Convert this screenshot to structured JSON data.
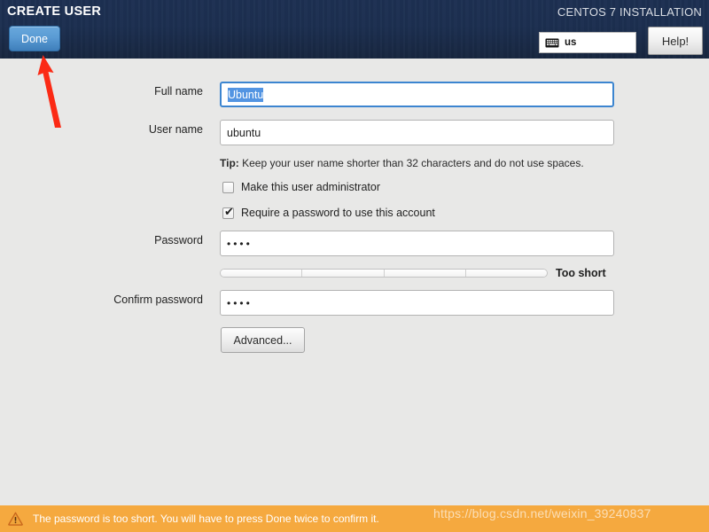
{
  "header": {
    "title": "CREATE USER",
    "product": "CENTOS 7 INSTALLATION",
    "done_label": "Done",
    "help_label": "Help!",
    "keyboard_layout": "us",
    "keyboard_icon": "keyboard-icon",
    "bg_color": "#1c2f50",
    "done_color": "#5a9bd4"
  },
  "form": {
    "full_name": {
      "label": "Full name",
      "value": "Ubuntu",
      "selected": true,
      "focused": true
    },
    "user_name": {
      "label": "User name",
      "value": "ubuntu",
      "selected": false,
      "focused": false
    },
    "tip": {
      "prefix": "Tip:",
      "text": "Keep your user name shorter than 32 characters and do not use spaces."
    },
    "checkboxes": [
      {
        "label": "Make this user administrator",
        "checked": false,
        "mark": ""
      },
      {
        "label": "Require a password to use this account",
        "checked": true,
        "mark": "✔"
      }
    ],
    "password": {
      "label": "Password",
      "value": "••••",
      "char_count": 4
    },
    "strength": {
      "label": "Too short",
      "segments": 4,
      "filled": 0
    },
    "confirm_password": {
      "label": "Confirm password",
      "value": "••••",
      "char_count": 4
    },
    "advanced_label": "Advanced..."
  },
  "warning": {
    "icon": "warning-triangle-icon",
    "message": "The password is too short. You will have to press Done twice to confirm it.",
    "bg_color": "#f5a93f"
  },
  "watermark": {
    "text": "https://blog.csdn.net/weixin_39240837"
  },
  "annotation": {
    "arrow_color": "#ff2200",
    "points_to": "done-button"
  }
}
